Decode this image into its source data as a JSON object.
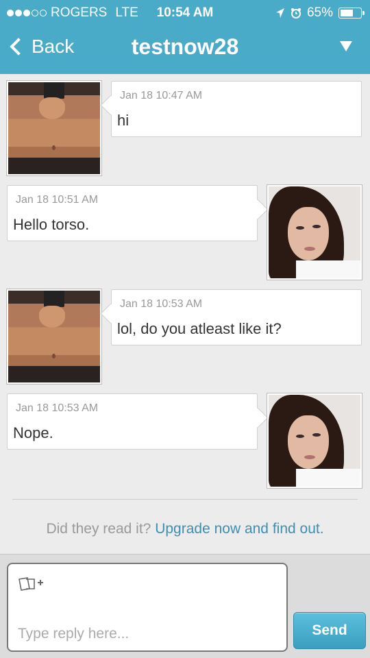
{
  "status_bar": {
    "carrier": "ROGERS",
    "network": "LTE",
    "time": "10:54 AM",
    "battery": "65%",
    "battery_level": 0.65
  },
  "nav": {
    "back_label": "Back",
    "title": "testnow28"
  },
  "messages": [
    {
      "sender": "torso",
      "side": "left",
      "time": "Jan 18 10:47 AM",
      "text": "hi"
    },
    {
      "sender": "girl",
      "side": "right",
      "time": "Jan 18 10:51 AM",
      "text": "Hello torso."
    },
    {
      "sender": "torso",
      "side": "left",
      "time": "Jan 18 10:53 AM",
      "text": "lol, do you atleast like it?"
    },
    {
      "sender": "girl",
      "side": "right",
      "time": "Jan 18 10:53 AM",
      "text": "Nope."
    }
  ],
  "upsell": {
    "prefix": "Did they read it?",
    "link": "Upgrade now and find out."
  },
  "composer": {
    "placeholder": "Type reply here...",
    "send_label": "Send"
  },
  "colors": {
    "header": "#4aabc9",
    "link": "#3b8fb0",
    "send": "#3a9fc0"
  }
}
